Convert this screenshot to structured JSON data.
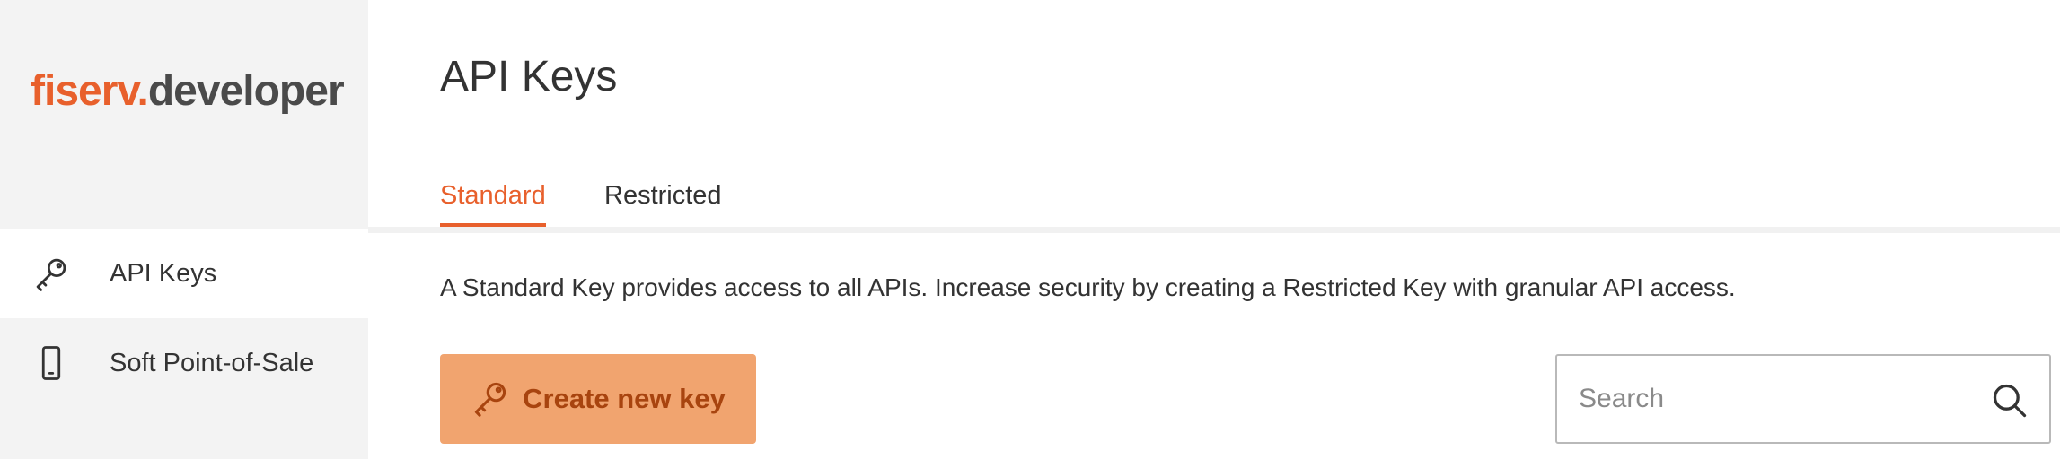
{
  "logo": {
    "brand": "fiserv.",
    "product": "developer"
  },
  "sidebar": {
    "items": [
      {
        "label": "API Keys",
        "icon": "key-icon",
        "active": true
      },
      {
        "label": "Soft Point-of-Sale",
        "icon": "mobile-phone-icon",
        "active": false
      }
    ]
  },
  "main": {
    "title": "API Keys",
    "tabs": [
      {
        "label": "Standard",
        "active": true
      },
      {
        "label": "Restricted",
        "active": false
      }
    ],
    "description": "A Standard Key provides access to all APIs. Increase security by creating a Restricted Key with granular API access.",
    "create_button": {
      "label": "Create new key",
      "icon": "key-icon"
    },
    "search": {
      "placeholder": "Search",
      "value": "",
      "icon": "search-icon"
    }
  },
  "colors": {
    "accent": "#e8602c",
    "button_bg": "#f1a46f",
    "button_text": "#a8440f",
    "sidebar_bg": "#f3f3f3"
  }
}
